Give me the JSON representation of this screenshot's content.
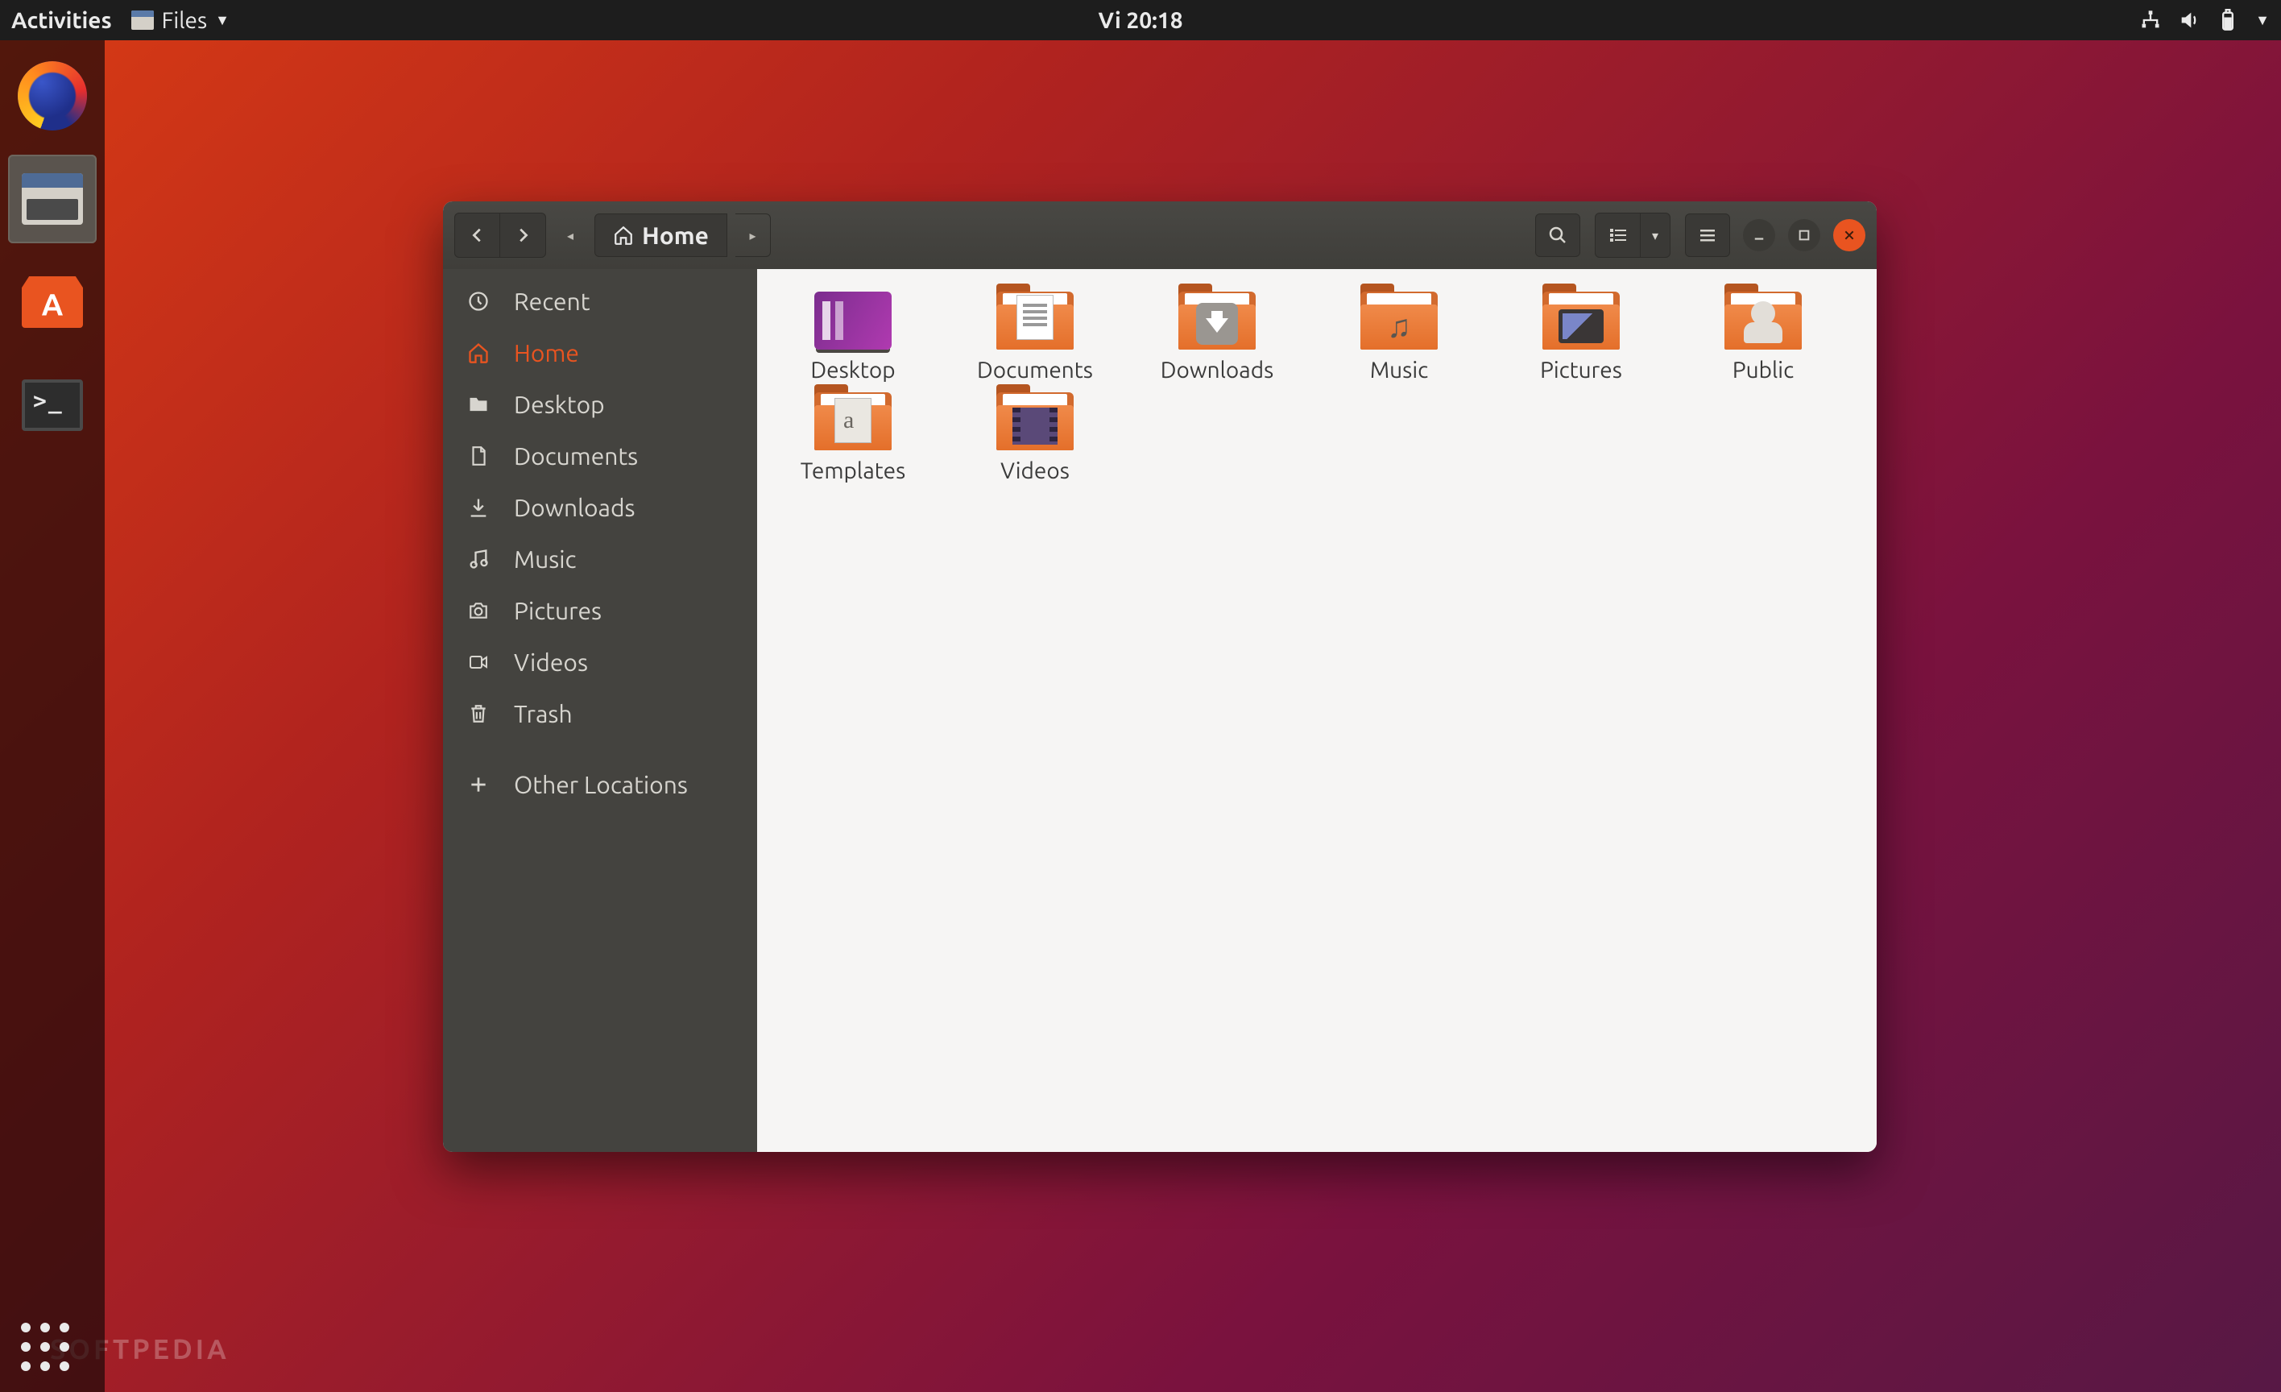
{
  "topbar": {
    "activities": "Activities",
    "app_name": "Files",
    "clock": "Vi 20:18"
  },
  "window": {
    "path_label": "Home"
  },
  "sidebar": {
    "items": [
      {
        "label": "Recent",
        "icon": "clock-icon"
      },
      {
        "label": "Home",
        "icon": "home-icon"
      },
      {
        "label": "Desktop",
        "icon": "folder-icon"
      },
      {
        "label": "Documents",
        "icon": "document-icon"
      },
      {
        "label": "Downloads",
        "icon": "download-icon"
      },
      {
        "label": "Music",
        "icon": "music-icon"
      },
      {
        "label": "Pictures",
        "icon": "camera-icon"
      },
      {
        "label": "Videos",
        "icon": "video-icon"
      },
      {
        "label": "Trash",
        "icon": "trash-icon"
      }
    ],
    "other_locations": "Other Locations"
  },
  "folders": [
    {
      "label": "Desktop",
      "kind": "desktop"
    },
    {
      "label": "Documents",
      "kind": "doc"
    },
    {
      "label": "Downloads",
      "kind": "arrow"
    },
    {
      "label": "Music",
      "kind": "music"
    },
    {
      "label": "Pictures",
      "kind": "pics"
    },
    {
      "label": "Public",
      "kind": "public"
    },
    {
      "label": "Templates",
      "kind": "template"
    },
    {
      "label": "Videos",
      "kind": "video"
    }
  ],
  "watermark": "SOFTPEDIA"
}
